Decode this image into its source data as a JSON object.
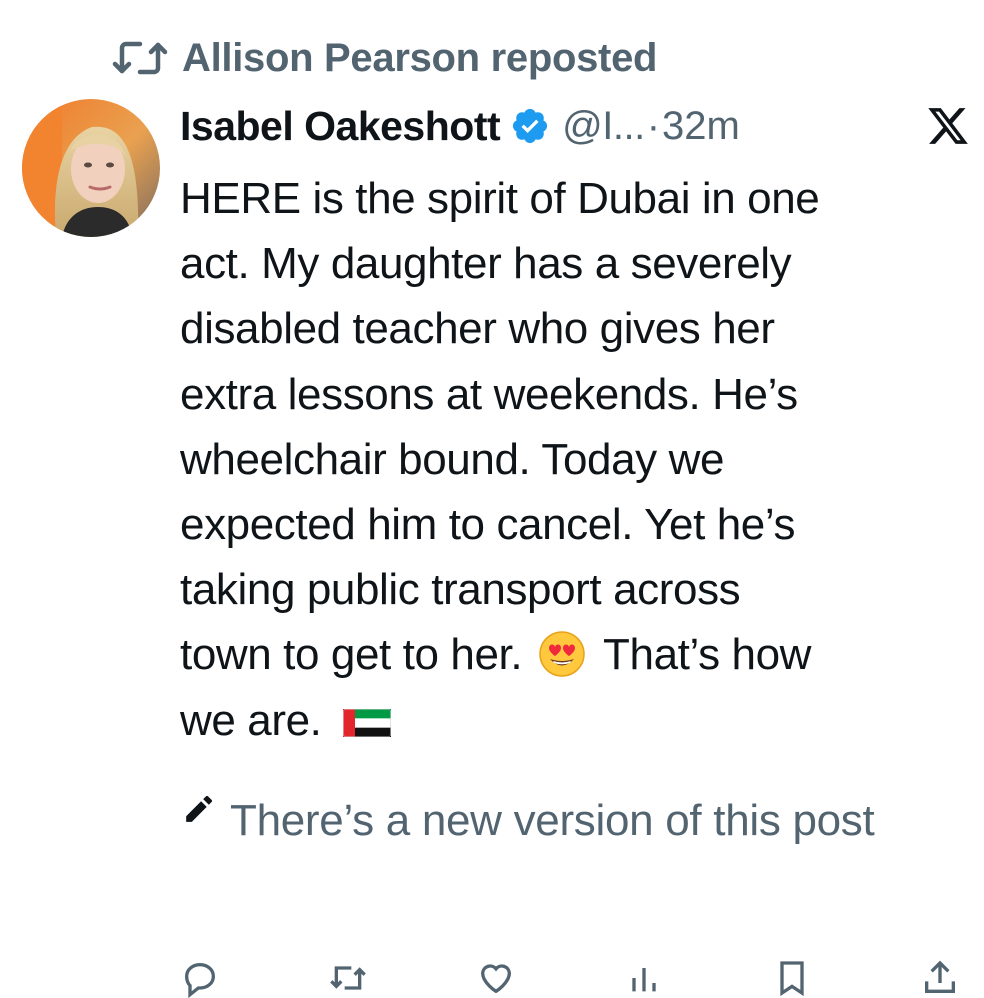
{
  "repost": {
    "icon": "repost-icon",
    "label": "Allison Pearson reposted"
  },
  "author": {
    "display_name": "Isabel Oakeshott",
    "verified_icon": "verified-badge-icon",
    "handle": "@I...",
    "separator": "·",
    "time": "32m",
    "platform_icon": "x-logo-icon",
    "avatar": "author-avatar"
  },
  "post": {
    "lines": [
      "HERE is the spirit of Dubai in one",
      "act. My daughter has a severely",
      "disabled teacher who gives her",
      "extra lessons at weekends. He’s",
      "wheelchair bound. Today we",
      "expected him to cancel. Yet he’s",
      "taking public transport across"
    ],
    "line8_before_emoji": "town to get to her.",
    "line8_after_emoji": "That’s how",
    "line9_text": "we are.",
    "emoji_icon": "heart-eyes-emoji-icon",
    "flag_icon": "uae-flag-icon"
  },
  "edit_notice": {
    "icon": "pencil-icon",
    "text": "There’s a new version of this post"
  },
  "actions": {
    "icons": [
      "reply-icon",
      "repost-icon",
      "like-icon",
      "views-icon",
      "bookmark-icon",
      "share-icon"
    ]
  },
  "colors": {
    "text_primary": "#0f1419",
    "text_secondary": "#536471",
    "verified_blue": "#1d9bf0",
    "flag_red": "#e3262c",
    "flag_green": "#009a44",
    "flag_black": "#111111",
    "emoji_yellow": "#ffc83d"
  }
}
